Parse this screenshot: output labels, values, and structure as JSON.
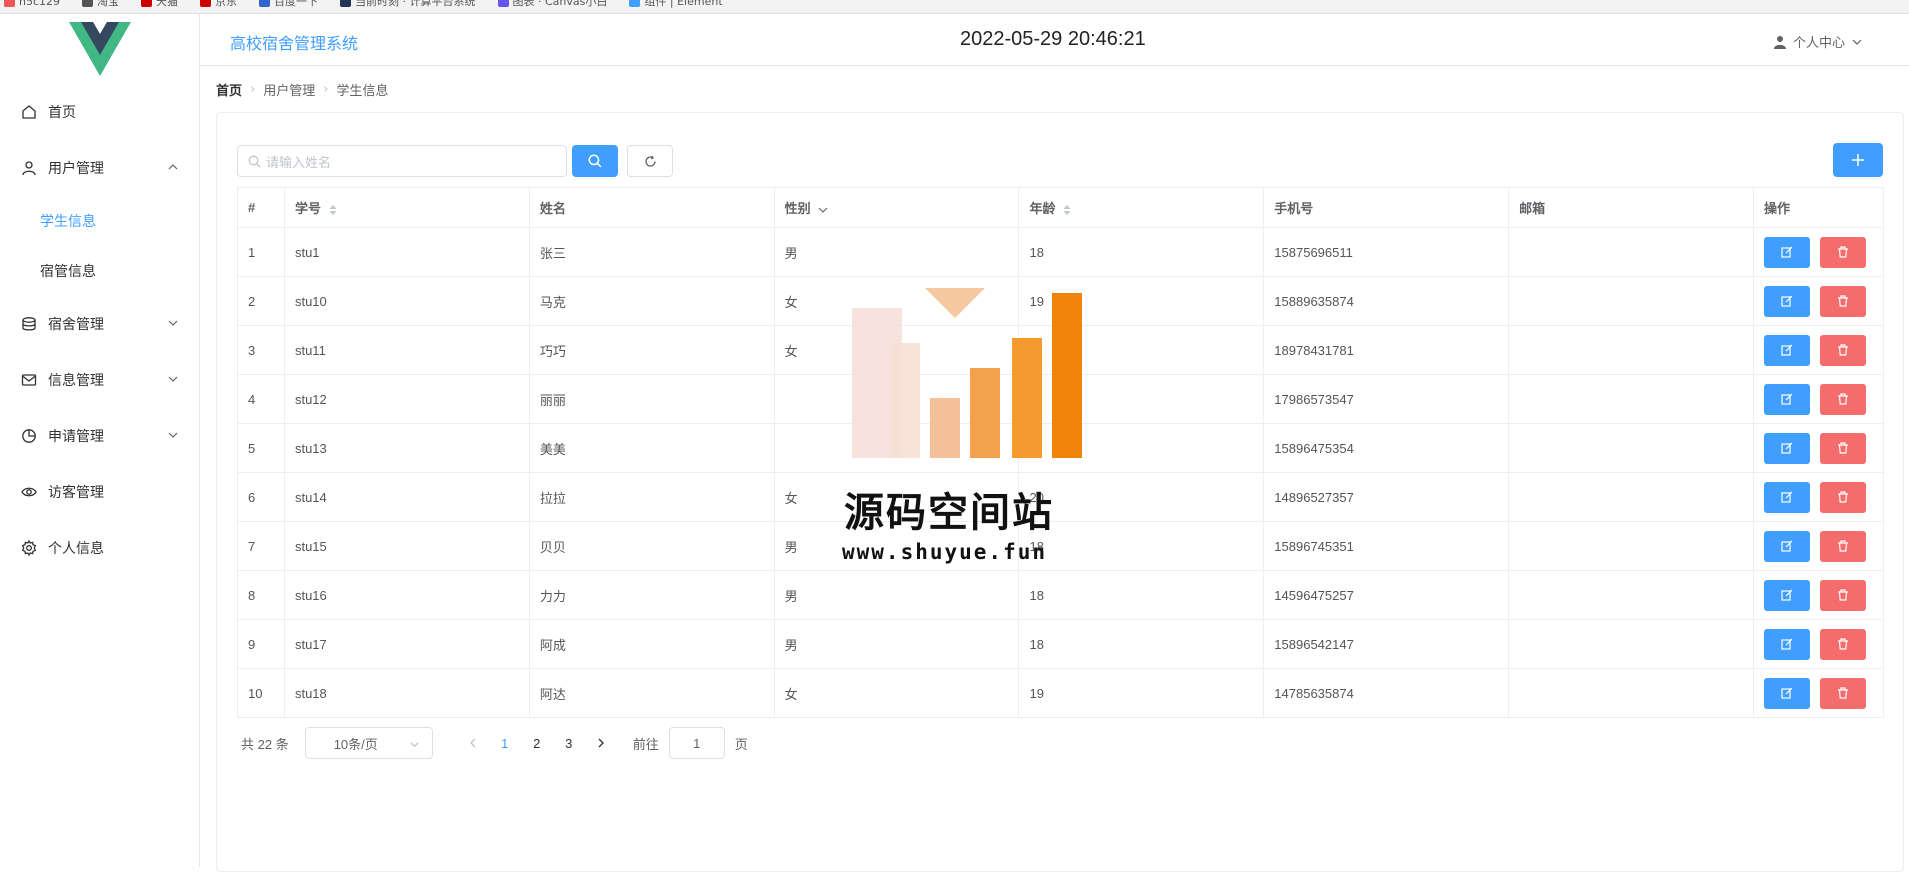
{
  "browser": {
    "bookmarks": [
      {
        "label": "h5c129",
        "color": "#e55"
      },
      {
        "label": "淘宝",
        "color": "#555"
      },
      {
        "label": "天猫",
        "color": "#c00"
      },
      {
        "label": "京东",
        "color": "#c00"
      },
      {
        "label": "百度一下",
        "color": "#3366cc"
      },
      {
        "label": "当前时刻 · 计算平台系统",
        "color": "#235"
      },
      {
        "label": "图表 · Canvas小白",
        "color": "#6655ee"
      },
      {
        "label": "组件 | Element",
        "color": "#409eff"
      }
    ]
  },
  "header": {
    "app_title": "高校宿舍管理系统",
    "clock": "2022-05-29 20:46:21",
    "user_center": "个人中心"
  },
  "sidebar": {
    "items": [
      {
        "label": "首页",
        "icon": "home-icon"
      },
      {
        "label": "用户管理",
        "icon": "user-icon",
        "expanded": true,
        "children": [
          {
            "label": "学生信息",
            "active": true
          },
          {
            "label": "宿管信息",
            "active": false
          }
        ]
      },
      {
        "label": "宿舍管理",
        "icon": "database-icon"
      },
      {
        "label": "信息管理",
        "icon": "message-icon"
      },
      {
        "label": "申请管理",
        "icon": "pie-chart-icon"
      },
      {
        "label": "访客管理",
        "icon": "eye-icon"
      },
      {
        "label": "个人信息",
        "icon": "gear-icon"
      }
    ]
  },
  "breadcrumb": [
    "首页",
    "用户管理",
    "学生信息"
  ],
  "search": {
    "placeholder": "请输入姓名"
  },
  "table": {
    "headers": [
      "#",
      "学号",
      "姓名",
      "性别",
      "年龄",
      "手机号",
      "邮箱",
      "操作"
    ],
    "rows": [
      [
        "1",
        "stu1",
        "张三",
        "男",
        "18",
        "15875696511",
        ""
      ],
      [
        "2",
        "stu10",
        "马克",
        "女",
        "19",
        "15889635874",
        ""
      ],
      [
        "3",
        "stu11",
        "巧巧",
        "女",
        "",
        "18978431781",
        ""
      ],
      [
        "4",
        "stu12",
        "丽丽",
        "",
        "",
        "17986573547",
        ""
      ],
      [
        "5",
        "stu13",
        "美美",
        "",
        "",
        "15896475354",
        ""
      ],
      [
        "6",
        "stu14",
        "拉拉",
        "女",
        "20",
        "14896527357",
        ""
      ],
      [
        "7",
        "stu15",
        "贝贝",
        "男",
        "18",
        "15896745351",
        ""
      ],
      [
        "8",
        "stu16",
        "力力",
        "男",
        "18",
        "14596475257",
        ""
      ],
      [
        "9",
        "stu17",
        "阿成",
        "男",
        "18",
        "15896542147",
        ""
      ],
      [
        "10",
        "stu18",
        "阿达",
        "女",
        "19",
        "14785635874",
        ""
      ]
    ]
  },
  "pagination": {
    "total": "共 22 条",
    "page_size": "10条/页",
    "pages": [
      "1",
      "2",
      "3"
    ],
    "current": "1",
    "goto_prefix": "前往",
    "goto_value": "1",
    "goto_suffix": "页"
  },
  "watermark": {
    "title": "源码空间站",
    "url": "www.shuyue.fun"
  },
  "colors": {
    "primary": "#409eff",
    "danger": "#f56c6c",
    "watermark_orange": "#f0830a"
  }
}
